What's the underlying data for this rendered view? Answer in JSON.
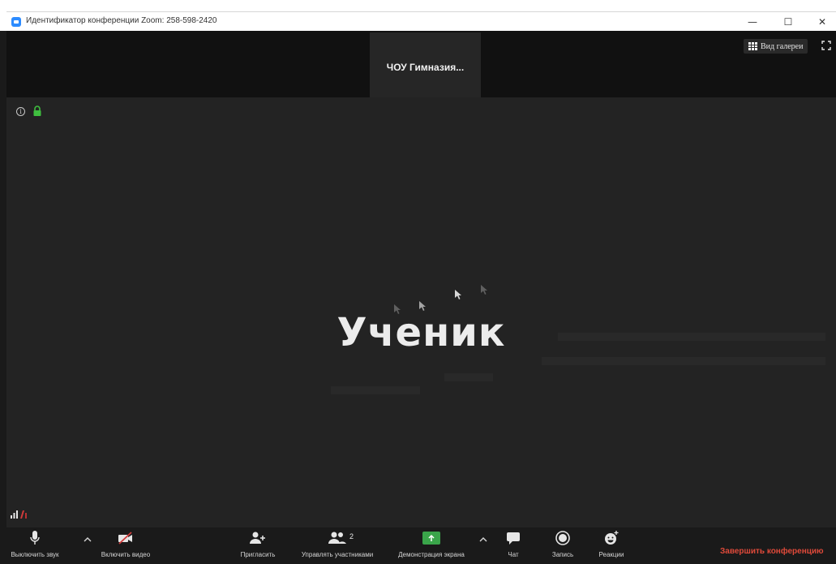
{
  "window": {
    "title": "Идентификатор конференции Zoom: 258-598-2420",
    "minimize": "—",
    "maximize": "☐",
    "close": "✕"
  },
  "top_strip": {
    "thumbnail_name": "ЧОУ Гимназия...",
    "gallery_view_label": "Вид галереи"
  },
  "main": {
    "info_symbol": "i",
    "speaker_name": "Ученик"
  },
  "toolbar": {
    "mute_label": "Выключить звук",
    "video_label": "Включить видео",
    "invite_label": "Пригласить",
    "participants_label": "Управлять участниками",
    "participants_count": "2",
    "share_label": "Демонстрация экрана",
    "chat_label": "Чат",
    "record_label": "Запись",
    "reactions_label": "Реакции",
    "end_label": "Завершить конференцию"
  },
  "colors": {
    "background": "#232323",
    "toolbar": "#1a1a1a",
    "share_green": "#3aa54a",
    "end_red": "#e04a3a",
    "zoom_blue": "#2d8cff",
    "lock_green": "#3fbf3f"
  },
  "icons": [
    "zoom-app-icon",
    "gallery-grid-icon",
    "fullscreen-icon",
    "info-icon",
    "lock-icon",
    "signal-icon",
    "microphone-icon",
    "video-off-icon",
    "add-person-icon",
    "participants-icon",
    "share-screen-icon",
    "chat-icon",
    "record-icon",
    "reactions-icon",
    "chevron-up-icon"
  ]
}
